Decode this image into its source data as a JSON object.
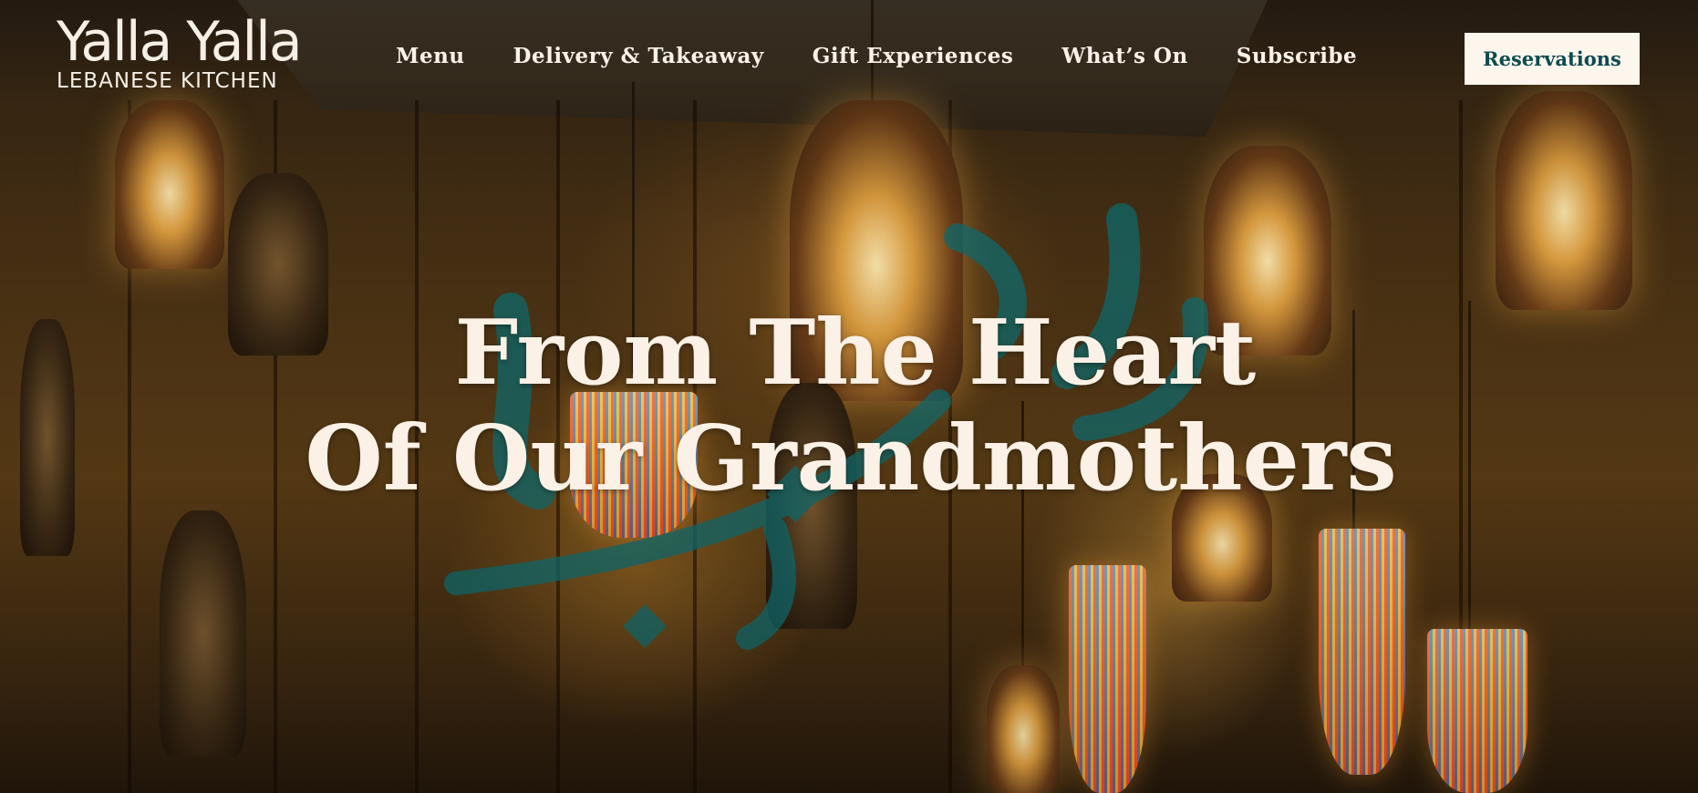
{
  "brand": {
    "logo_main": "Yalla Yalla",
    "logo_sub": "LEBANESE KITCHEN"
  },
  "nav": {
    "items": [
      {
        "label": "Menu"
      },
      {
        "label": "Delivery & Takeaway"
      },
      {
        "label": "Gift Experiences"
      },
      {
        "label": "What’s On"
      },
      {
        "label": "Subscribe"
      }
    ],
    "cta_label": "Reservations"
  },
  "hero": {
    "line1": "From The Heart",
    "line2": "Of Our Grandmothers",
    "background_image": "restaurant-lanterns-photo",
    "overlay_mark": "arabic-calligraphy-mark"
  },
  "colors": {
    "accent_teal": "#0d4b4f",
    "headline_cream": "#fbf1e6",
    "calligraphy_teal": "#0f6e71"
  }
}
